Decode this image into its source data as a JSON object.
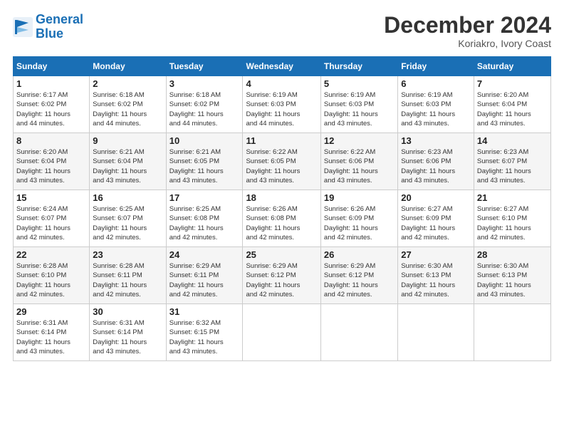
{
  "logo": {
    "line1": "General",
    "line2": "Blue"
  },
  "title": "December 2024",
  "location": "Koriakro, Ivory Coast",
  "days_of_week": [
    "Sunday",
    "Monday",
    "Tuesday",
    "Wednesday",
    "Thursday",
    "Friday",
    "Saturday"
  ],
  "weeks": [
    [
      {
        "day": "1",
        "info": "Sunrise: 6:17 AM\nSunset: 6:02 PM\nDaylight: 11 hours\nand 44 minutes."
      },
      {
        "day": "2",
        "info": "Sunrise: 6:18 AM\nSunset: 6:02 PM\nDaylight: 11 hours\nand 44 minutes."
      },
      {
        "day": "3",
        "info": "Sunrise: 6:18 AM\nSunset: 6:02 PM\nDaylight: 11 hours\nand 44 minutes."
      },
      {
        "day": "4",
        "info": "Sunrise: 6:19 AM\nSunset: 6:03 PM\nDaylight: 11 hours\nand 44 minutes."
      },
      {
        "day": "5",
        "info": "Sunrise: 6:19 AM\nSunset: 6:03 PM\nDaylight: 11 hours\nand 43 minutes."
      },
      {
        "day": "6",
        "info": "Sunrise: 6:19 AM\nSunset: 6:03 PM\nDaylight: 11 hours\nand 43 minutes."
      },
      {
        "day": "7",
        "info": "Sunrise: 6:20 AM\nSunset: 6:04 PM\nDaylight: 11 hours\nand 43 minutes."
      }
    ],
    [
      {
        "day": "8",
        "info": "Sunrise: 6:20 AM\nSunset: 6:04 PM\nDaylight: 11 hours\nand 43 minutes."
      },
      {
        "day": "9",
        "info": "Sunrise: 6:21 AM\nSunset: 6:04 PM\nDaylight: 11 hours\nand 43 minutes."
      },
      {
        "day": "10",
        "info": "Sunrise: 6:21 AM\nSunset: 6:05 PM\nDaylight: 11 hours\nand 43 minutes."
      },
      {
        "day": "11",
        "info": "Sunrise: 6:22 AM\nSunset: 6:05 PM\nDaylight: 11 hours\nand 43 minutes."
      },
      {
        "day": "12",
        "info": "Sunrise: 6:22 AM\nSunset: 6:06 PM\nDaylight: 11 hours\nand 43 minutes."
      },
      {
        "day": "13",
        "info": "Sunrise: 6:23 AM\nSunset: 6:06 PM\nDaylight: 11 hours\nand 43 minutes."
      },
      {
        "day": "14",
        "info": "Sunrise: 6:23 AM\nSunset: 6:07 PM\nDaylight: 11 hours\nand 43 minutes."
      }
    ],
    [
      {
        "day": "15",
        "info": "Sunrise: 6:24 AM\nSunset: 6:07 PM\nDaylight: 11 hours\nand 42 minutes."
      },
      {
        "day": "16",
        "info": "Sunrise: 6:25 AM\nSunset: 6:07 PM\nDaylight: 11 hours\nand 42 minutes."
      },
      {
        "day": "17",
        "info": "Sunrise: 6:25 AM\nSunset: 6:08 PM\nDaylight: 11 hours\nand 42 minutes."
      },
      {
        "day": "18",
        "info": "Sunrise: 6:26 AM\nSunset: 6:08 PM\nDaylight: 11 hours\nand 42 minutes."
      },
      {
        "day": "19",
        "info": "Sunrise: 6:26 AM\nSunset: 6:09 PM\nDaylight: 11 hours\nand 42 minutes."
      },
      {
        "day": "20",
        "info": "Sunrise: 6:27 AM\nSunset: 6:09 PM\nDaylight: 11 hours\nand 42 minutes."
      },
      {
        "day": "21",
        "info": "Sunrise: 6:27 AM\nSunset: 6:10 PM\nDaylight: 11 hours\nand 42 minutes."
      }
    ],
    [
      {
        "day": "22",
        "info": "Sunrise: 6:28 AM\nSunset: 6:10 PM\nDaylight: 11 hours\nand 42 minutes."
      },
      {
        "day": "23",
        "info": "Sunrise: 6:28 AM\nSunset: 6:11 PM\nDaylight: 11 hours\nand 42 minutes."
      },
      {
        "day": "24",
        "info": "Sunrise: 6:29 AM\nSunset: 6:11 PM\nDaylight: 11 hours\nand 42 minutes."
      },
      {
        "day": "25",
        "info": "Sunrise: 6:29 AM\nSunset: 6:12 PM\nDaylight: 11 hours\nand 42 minutes."
      },
      {
        "day": "26",
        "info": "Sunrise: 6:29 AM\nSunset: 6:12 PM\nDaylight: 11 hours\nand 42 minutes."
      },
      {
        "day": "27",
        "info": "Sunrise: 6:30 AM\nSunset: 6:13 PM\nDaylight: 11 hours\nand 42 minutes."
      },
      {
        "day": "28",
        "info": "Sunrise: 6:30 AM\nSunset: 6:13 PM\nDaylight: 11 hours\nand 43 minutes."
      }
    ],
    [
      {
        "day": "29",
        "info": "Sunrise: 6:31 AM\nSunset: 6:14 PM\nDaylight: 11 hours\nand 43 minutes."
      },
      {
        "day": "30",
        "info": "Sunrise: 6:31 AM\nSunset: 6:14 PM\nDaylight: 11 hours\nand 43 minutes."
      },
      {
        "day": "31",
        "info": "Sunrise: 6:32 AM\nSunset: 6:15 PM\nDaylight: 11 hours\nand 43 minutes."
      },
      null,
      null,
      null,
      null
    ]
  ]
}
